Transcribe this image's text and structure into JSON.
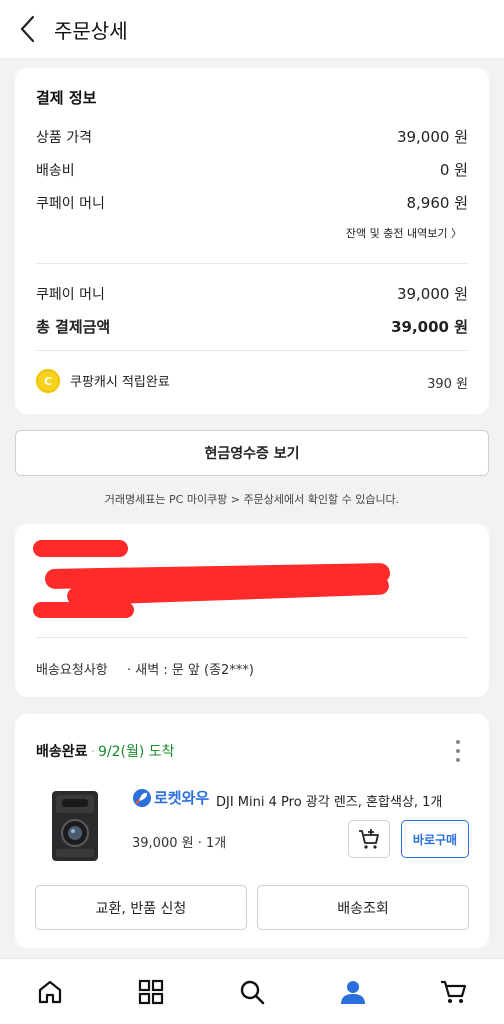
{
  "header": {
    "title": "주문상세"
  },
  "payment": {
    "section_title": "결제 정보",
    "rows": [
      {
        "label": "상품 가격",
        "value": "39,000 원"
      },
      {
        "label": "배송비",
        "value": "0 원"
      },
      {
        "label": "쿠페이 머니",
        "value": "8,960 원"
      }
    ],
    "history_link": "잔액 및 충전 내역보기 〉",
    "paid_with": {
      "label": "쿠페이 머니",
      "value": "39,000 원"
    },
    "total": {
      "label": "총 결제금액",
      "value": "39,000 원"
    },
    "cash": {
      "icon_letter": "C",
      "label": "쿠팡캐시 적립완료",
      "value": "390 원"
    }
  },
  "receipt": {
    "button_label": "현금영수증 보기",
    "note": "거래명세표는 PC 마이쿠팡 > 주문상세에서 확인할 수 있습니다."
  },
  "address": {
    "request_label": "배송요청사항",
    "request_value": "· 새벽 : 문 앞 (종2***)"
  },
  "delivery": {
    "status": "배송완료",
    "separator": "·",
    "arrival": "9/2(월) 도착",
    "badge": "로켓와우",
    "product_name": "DJI Mini 4 Pro 광각 렌즈, 혼합색상, 1개",
    "price": "39,000 원 · 1개",
    "buy_now": "바로구매",
    "exchange_return": "교환, 반품 신청",
    "tracking": "배송조회"
  },
  "colors": {
    "accent_blue": "#2a6fdb",
    "delivered_green": "#188a2a",
    "cash_yellow": "#f7d21a",
    "redaction_red": "#ff2a2a"
  },
  "icons": {
    "back": "chevron-left-icon",
    "cart_add": "cart-plus-icon",
    "nav": [
      "home-icon",
      "category-grid-icon",
      "search-icon",
      "my-coupang-person-icon",
      "cart-icon"
    ]
  }
}
